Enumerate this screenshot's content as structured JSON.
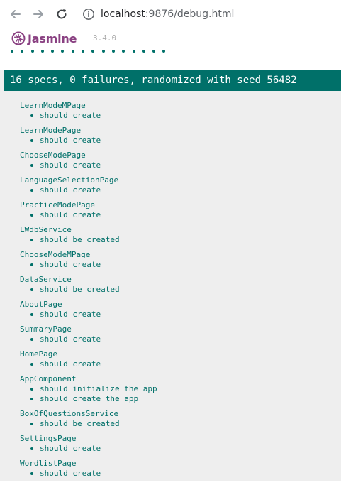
{
  "browser": {
    "url_host": "localhost",
    "url_rest": ":9876/debug.html"
  },
  "jasmine": {
    "logo_text": "Jasmine",
    "version": "3.4.0",
    "dot_count": 16,
    "dot_color": "#007069",
    "summary": "16 specs, 0 failures, randomized with seed 56482"
  },
  "suites": [
    {
      "name": "LearnModeMPage",
      "specs": [
        "should create"
      ]
    },
    {
      "name": "LearnModePage",
      "specs": [
        "should create"
      ]
    },
    {
      "name": "ChooseModePage",
      "specs": [
        "should create"
      ]
    },
    {
      "name": "LanguageSelectionPage",
      "specs": [
        "should create"
      ]
    },
    {
      "name": "PracticeModePage",
      "specs": [
        "should create"
      ]
    },
    {
      "name": "LWdbService",
      "specs": [
        "should be created"
      ]
    },
    {
      "name": "ChooseModeMPage",
      "specs": [
        "should create"
      ]
    },
    {
      "name": "DataService",
      "specs": [
        "should be created"
      ]
    },
    {
      "name": "AboutPage",
      "specs": [
        "should create"
      ]
    },
    {
      "name": "SummaryPage",
      "specs": [
        "should create"
      ]
    },
    {
      "name": "HomePage",
      "specs": [
        "should create"
      ]
    },
    {
      "name": "AppComponent",
      "specs": [
        "should initialize the app",
        "should create the app"
      ]
    },
    {
      "name": "BoxOfQuestionsService",
      "specs": [
        "should be created"
      ]
    },
    {
      "name": "SettingsPage",
      "specs": [
        "should create"
      ]
    },
    {
      "name": "WordlistPage",
      "specs": [
        "should create"
      ]
    }
  ]
}
